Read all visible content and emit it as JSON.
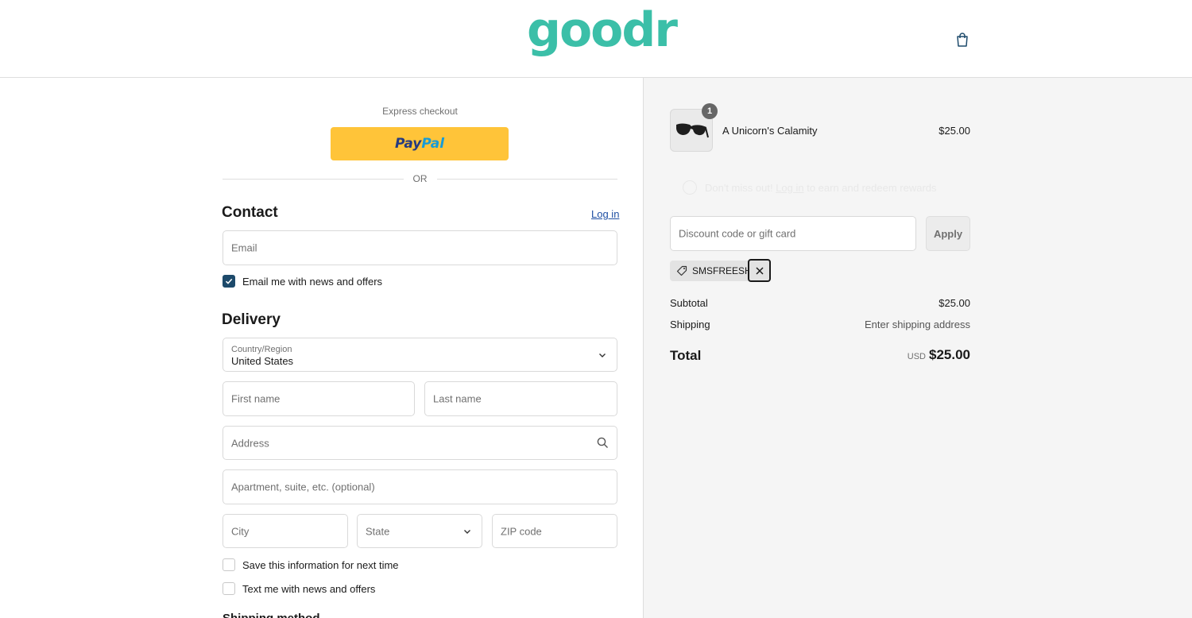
{
  "header": {
    "logo_text": "goodr",
    "cart_icon": "shopping-bag-icon"
  },
  "express": {
    "label": "Express checkout",
    "paypal_dark": "Pay",
    "paypal_light": "Pal",
    "or_text": "OR"
  },
  "contact": {
    "title": "Contact",
    "login_link": "Log in",
    "email_placeholder": "Email",
    "news_checkbox_label": "Email me with news and offers",
    "news_checked": true
  },
  "delivery": {
    "title": "Delivery",
    "country_label": "Country/Region",
    "country_value": "United States",
    "first_name_placeholder": "First name",
    "last_name_placeholder": "Last name",
    "address_placeholder": "Address",
    "apartment_placeholder": "Apartment, suite, etc. (optional)",
    "city_placeholder": "City",
    "state_placeholder": "State",
    "zip_placeholder": "ZIP code",
    "save_info_label": "Save this information for next time",
    "text_me_label": "Text me with news and offers",
    "shipping_method_title": "Shipping method"
  },
  "order": {
    "item_name": "A Unicorn's Calamity",
    "item_price": "$25.00",
    "item_quantity": "1",
    "rewards_prefix": "Don't miss out! ",
    "rewards_link": "Log in",
    "rewards_suffix": " to earn and redeem rewards",
    "discount_placeholder": "Discount code or gift card",
    "apply_label": "Apply",
    "applied_code": "SMSFREESHIP",
    "subtotal_label": "Subtotal",
    "subtotal_value": "$25.00",
    "shipping_label": "Shipping",
    "shipping_value": "Enter shipping address",
    "total_label": "Total",
    "total_currency": "USD",
    "total_value": "$25.00"
  },
  "colors": {
    "brand": "#3bbfa8",
    "paypal_yellow": "#ffc439",
    "checkbox_checked": "#1d4a6b",
    "link": "#1f4fa3"
  }
}
